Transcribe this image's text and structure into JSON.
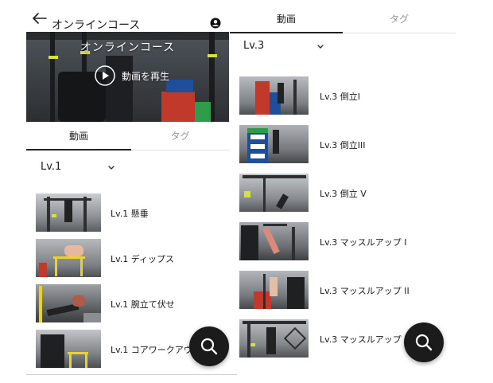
{
  "left_screen": {
    "header": {
      "title": "オンラインコース",
      "back_icon": "arrow-left-icon",
      "profile_icon": "account-circle-icon"
    },
    "hero": {
      "title": "オンラインコース",
      "play_label": "動画を再生",
      "play_icon": "play-circle-icon"
    },
    "tabs": [
      {
        "label": "動画",
        "active": true
      },
      {
        "label": "タグ",
        "active": false
      }
    ],
    "level_select": {
      "value": "Lv.1",
      "chevron_icon": "chevron-down-icon"
    },
    "items": [
      {
        "label": "Lv.1 懸垂"
      },
      {
        "label": "Lv.1 ディップス"
      },
      {
        "label": "Lv.1 腕立て伏せ"
      },
      {
        "label": "Lv.1 コアワークアウト"
      }
    ],
    "fab": {
      "icon": "search-icon"
    }
  },
  "right_screen": {
    "tabs": [
      {
        "label": "動画",
        "active": true
      },
      {
        "label": "タグ",
        "active": false
      }
    ],
    "level_select": {
      "value": "Lv.3",
      "chevron_icon": "chevron-down-icon"
    },
    "items": [
      {
        "label": "Lv.3 倒立I"
      },
      {
        "label": "Lv.3 倒立III"
      },
      {
        "label": "Lv.3 倒立 V"
      },
      {
        "label": "Lv.3 マッスルアップ I"
      },
      {
        "label": "Lv.3 マッスルアップ II"
      },
      {
        "label": "Lv.3 マッスルアップ III"
      }
    ],
    "fab": {
      "icon": "search-icon"
    }
  },
  "colors": {
    "fab": "#1b1b1b",
    "accent_yellow": "#d6e23a",
    "crate_red": "#c0392b",
    "crate_blue": "#1f4f9a",
    "crate_green": "#2e9d4b"
  }
}
